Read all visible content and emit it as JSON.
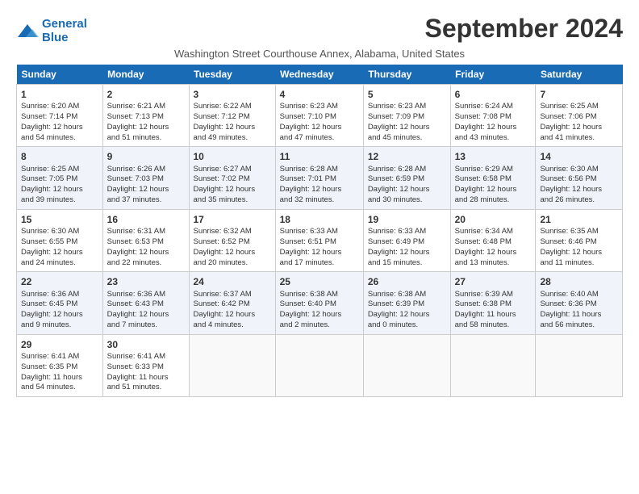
{
  "header": {
    "logo_line1": "General",
    "logo_line2": "Blue",
    "month": "September 2024",
    "location": "Washington Street Courthouse Annex, Alabama, United States"
  },
  "weekdays": [
    "Sunday",
    "Monday",
    "Tuesday",
    "Wednesday",
    "Thursday",
    "Friday",
    "Saturday"
  ],
  "weeks": [
    [
      {
        "day": "1",
        "info": "Sunrise: 6:20 AM\nSunset: 7:14 PM\nDaylight: 12 hours\nand 54 minutes."
      },
      {
        "day": "2",
        "info": "Sunrise: 6:21 AM\nSunset: 7:13 PM\nDaylight: 12 hours\nand 51 minutes."
      },
      {
        "day": "3",
        "info": "Sunrise: 6:22 AM\nSunset: 7:12 PM\nDaylight: 12 hours\nand 49 minutes."
      },
      {
        "day": "4",
        "info": "Sunrise: 6:23 AM\nSunset: 7:10 PM\nDaylight: 12 hours\nand 47 minutes."
      },
      {
        "day": "5",
        "info": "Sunrise: 6:23 AM\nSunset: 7:09 PM\nDaylight: 12 hours\nand 45 minutes."
      },
      {
        "day": "6",
        "info": "Sunrise: 6:24 AM\nSunset: 7:08 PM\nDaylight: 12 hours\nand 43 minutes."
      },
      {
        "day": "7",
        "info": "Sunrise: 6:25 AM\nSunset: 7:06 PM\nDaylight: 12 hours\nand 41 minutes."
      }
    ],
    [
      {
        "day": "8",
        "info": "Sunrise: 6:25 AM\nSunset: 7:05 PM\nDaylight: 12 hours\nand 39 minutes."
      },
      {
        "day": "9",
        "info": "Sunrise: 6:26 AM\nSunset: 7:03 PM\nDaylight: 12 hours\nand 37 minutes."
      },
      {
        "day": "10",
        "info": "Sunrise: 6:27 AM\nSunset: 7:02 PM\nDaylight: 12 hours\nand 35 minutes."
      },
      {
        "day": "11",
        "info": "Sunrise: 6:28 AM\nSunset: 7:01 PM\nDaylight: 12 hours\nand 32 minutes."
      },
      {
        "day": "12",
        "info": "Sunrise: 6:28 AM\nSunset: 6:59 PM\nDaylight: 12 hours\nand 30 minutes."
      },
      {
        "day": "13",
        "info": "Sunrise: 6:29 AM\nSunset: 6:58 PM\nDaylight: 12 hours\nand 28 minutes."
      },
      {
        "day": "14",
        "info": "Sunrise: 6:30 AM\nSunset: 6:56 PM\nDaylight: 12 hours\nand 26 minutes."
      }
    ],
    [
      {
        "day": "15",
        "info": "Sunrise: 6:30 AM\nSunset: 6:55 PM\nDaylight: 12 hours\nand 24 minutes."
      },
      {
        "day": "16",
        "info": "Sunrise: 6:31 AM\nSunset: 6:53 PM\nDaylight: 12 hours\nand 22 minutes."
      },
      {
        "day": "17",
        "info": "Sunrise: 6:32 AM\nSunset: 6:52 PM\nDaylight: 12 hours\nand 20 minutes."
      },
      {
        "day": "18",
        "info": "Sunrise: 6:33 AM\nSunset: 6:51 PM\nDaylight: 12 hours\nand 17 minutes."
      },
      {
        "day": "19",
        "info": "Sunrise: 6:33 AM\nSunset: 6:49 PM\nDaylight: 12 hours\nand 15 minutes."
      },
      {
        "day": "20",
        "info": "Sunrise: 6:34 AM\nSunset: 6:48 PM\nDaylight: 12 hours\nand 13 minutes."
      },
      {
        "day": "21",
        "info": "Sunrise: 6:35 AM\nSunset: 6:46 PM\nDaylight: 12 hours\nand 11 minutes."
      }
    ],
    [
      {
        "day": "22",
        "info": "Sunrise: 6:36 AM\nSunset: 6:45 PM\nDaylight: 12 hours\nand 9 minutes."
      },
      {
        "day": "23",
        "info": "Sunrise: 6:36 AM\nSunset: 6:43 PM\nDaylight: 12 hours\nand 7 minutes."
      },
      {
        "day": "24",
        "info": "Sunrise: 6:37 AM\nSunset: 6:42 PM\nDaylight: 12 hours\nand 4 minutes."
      },
      {
        "day": "25",
        "info": "Sunrise: 6:38 AM\nSunset: 6:40 PM\nDaylight: 12 hours\nand 2 minutes."
      },
      {
        "day": "26",
        "info": "Sunrise: 6:38 AM\nSunset: 6:39 PM\nDaylight: 12 hours\nand 0 minutes."
      },
      {
        "day": "27",
        "info": "Sunrise: 6:39 AM\nSunset: 6:38 PM\nDaylight: 11 hours\nand 58 minutes."
      },
      {
        "day": "28",
        "info": "Sunrise: 6:40 AM\nSunset: 6:36 PM\nDaylight: 11 hours\nand 56 minutes."
      }
    ],
    [
      {
        "day": "29",
        "info": "Sunrise: 6:41 AM\nSunset: 6:35 PM\nDaylight: 11 hours\nand 54 minutes."
      },
      {
        "day": "30",
        "info": "Sunrise: 6:41 AM\nSunset: 6:33 PM\nDaylight: 11 hours\nand 51 minutes."
      },
      {
        "day": "",
        "info": ""
      },
      {
        "day": "",
        "info": ""
      },
      {
        "day": "",
        "info": ""
      },
      {
        "day": "",
        "info": ""
      },
      {
        "day": "",
        "info": ""
      }
    ]
  ]
}
